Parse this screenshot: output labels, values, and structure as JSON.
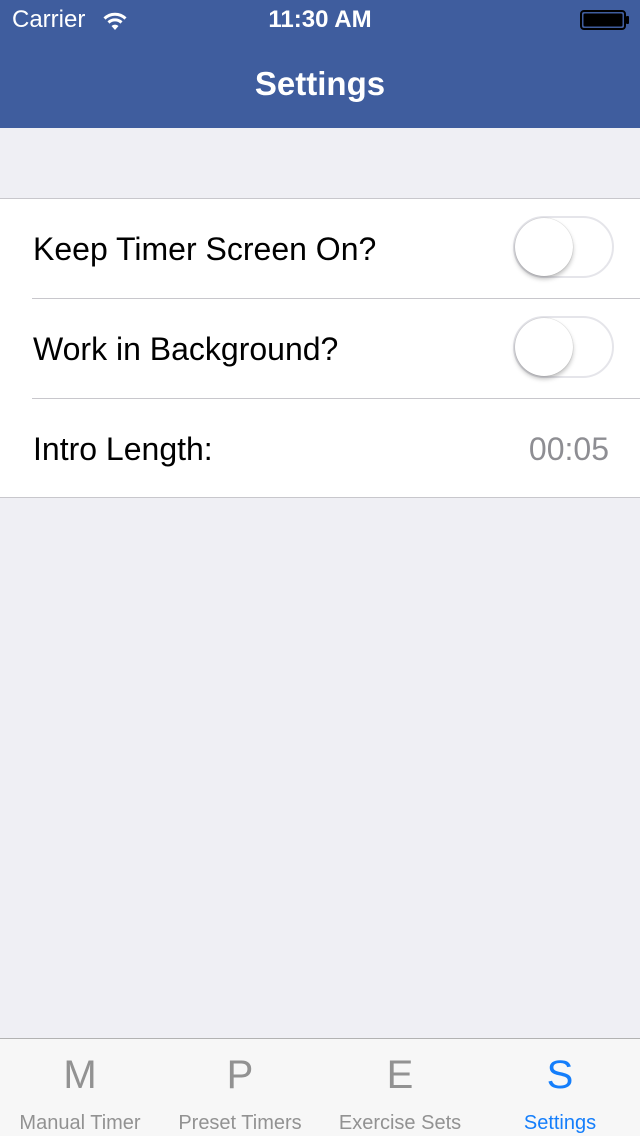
{
  "status_bar": {
    "carrier": "Carrier",
    "time": "11:30 AM"
  },
  "nav": {
    "title": "Settings"
  },
  "settings": {
    "keep_screen_on": {
      "label": "Keep Timer Screen On?",
      "enabled": false
    },
    "work_in_background": {
      "label": "Work in Background?",
      "enabled": false
    },
    "intro_length": {
      "label": "Intro Length:",
      "value": "00:05"
    }
  },
  "tab_bar": {
    "tabs": [
      {
        "icon": "M",
        "label": "Manual Timer",
        "active": false
      },
      {
        "icon": "P",
        "label": "Preset Timers",
        "active": false
      },
      {
        "icon": "E",
        "label": "Exercise Sets",
        "active": false
      },
      {
        "icon": "S",
        "label": "Settings",
        "active": true
      }
    ]
  },
  "colors": {
    "nav_background": "#3f5d9e",
    "page_background": "#efeff4",
    "tab_active": "#147efb",
    "tab_inactive": "#929292",
    "value_text": "#8e8e93"
  }
}
